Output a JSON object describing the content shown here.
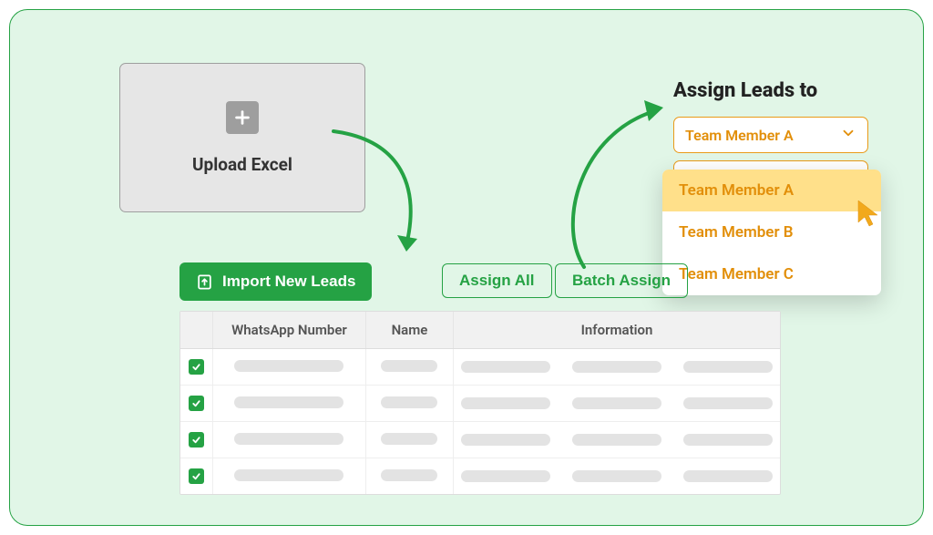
{
  "upload": {
    "label": "Upload Excel"
  },
  "import_button": "Import New Leads",
  "assign": {
    "title": "Assign Leads to",
    "selected": "Team Member A",
    "options": [
      "Team Member A",
      "Team Member B",
      "Team Member C"
    ]
  },
  "buttons": {
    "assign_all": "Assign All",
    "batch_assign": "Batch Assign"
  },
  "table": {
    "headers": {
      "whatsapp": "WhatsApp Number",
      "name": "Name",
      "info": "Information"
    },
    "rows": [
      {
        "checked": true
      },
      {
        "checked": true
      },
      {
        "checked": true
      },
      {
        "checked": true
      }
    ]
  },
  "colors": {
    "primary_green": "#25a244",
    "accent_orange": "#e28f0a",
    "highlight_yellow": "#ffe08a",
    "panel_bg": "#e1f6e7"
  }
}
